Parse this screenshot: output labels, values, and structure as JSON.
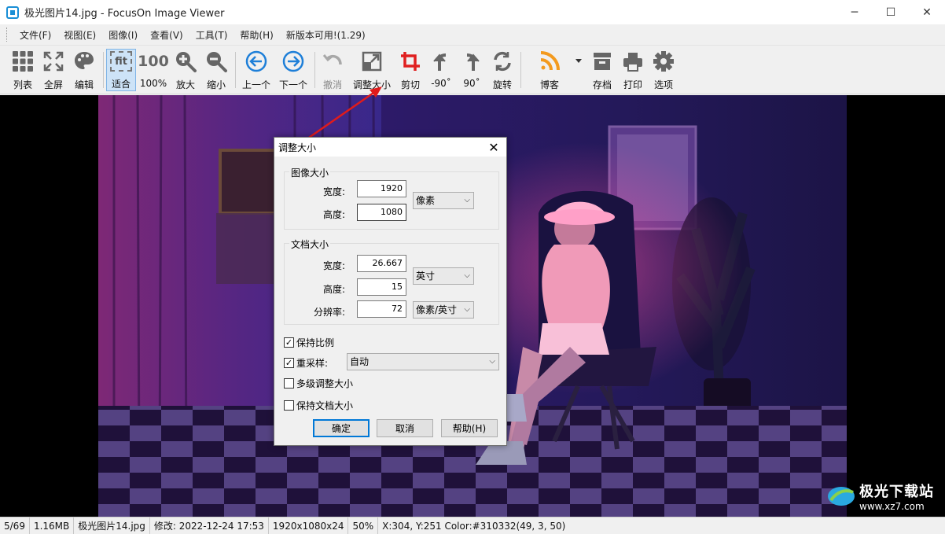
{
  "window": {
    "title": "极光图片14.jpg - FocusOn Image Viewer",
    "minimize": "─",
    "maximize": "☐",
    "close": "✕"
  },
  "menu": [
    "文件(F)",
    "视图(E)",
    "图像(I)",
    "查看(V)",
    "工具(T)",
    "帮助(H)",
    "新版本可用!(1.29)"
  ],
  "toolbar": {
    "list": "列表",
    "fullscreen": "全屏",
    "edit": "编辑",
    "fit": "适合",
    "fit_icon_text": "fit",
    "hundred": "100%",
    "hundred_icon_text": "100",
    "zoom_in": "放大",
    "zoom_out": "缩小",
    "prev": "上一个",
    "next": "下一个",
    "undo": "撤消",
    "resize": "调整大小",
    "crop": "剪切",
    "rot_left": "-90˚",
    "rot_right": "90˚",
    "rotate": "旋转",
    "blog": "博客",
    "archive": "存档",
    "print": "打印",
    "options": "选项"
  },
  "dialog": {
    "title": "调整大小",
    "image_size_group": "图像大小",
    "width_label": "宽度:",
    "height_label": "高度:",
    "img_width": "1920",
    "img_height": "1080",
    "pixel_unit": "像素",
    "doc_size_group": "文档大小",
    "doc_width": "26.667",
    "doc_height": "15",
    "resolution_label": "分辨率:",
    "resolution": "72",
    "inch_unit": "英寸",
    "res_unit": "像素/英寸",
    "keep_ratio": "保持比例",
    "keep_ratio_checked": true,
    "resample": "重采样:",
    "resample_checked": true,
    "resample_mode": "自动",
    "multi_level": "多级调整大小",
    "multi_level_checked": false,
    "keep_doc_size": "保持文档大小",
    "keep_doc_size_checked": false,
    "ok": "确定",
    "cancel": "取消",
    "help": "帮助(H)"
  },
  "status": {
    "index": "5/69",
    "filesize": "1.16MB",
    "filename": "极光图片14.jpg",
    "modified": "修改: 2022-12-24 17:53",
    "dimensions": "1920x1080x24",
    "zoom": "50%",
    "cursor": "X:304, Y:251 Color:#310332(49, 3, 50)"
  },
  "watermark": {
    "name": "极光下载站",
    "url": "www.xz7.com"
  },
  "colors": {
    "accent": "#0078d7",
    "annotation_arrow": "#e01b1b",
    "crop_icon": "#e02020",
    "blog_icon": "#f39a1e",
    "nav_icon": "#1e7fd8"
  }
}
